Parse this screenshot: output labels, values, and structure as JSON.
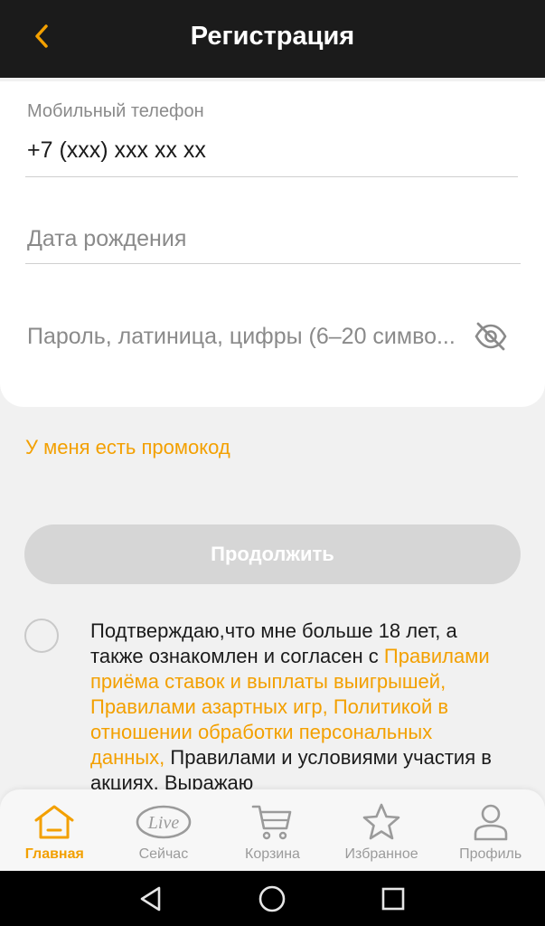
{
  "header": {
    "title": "Регистрация",
    "back_icon": "chevron-left-icon",
    "accent_color": "#f3a000"
  },
  "form": {
    "phone": {
      "label": "Мобильный телефон",
      "value": "+7 (xxx) xxx xx xx"
    },
    "birthdate": {
      "placeholder": "Дата рождения"
    },
    "password": {
      "placeholder": "Пароль, латиница, цифры (6–20 симво...",
      "visibility_icon": "eye-off-icon"
    }
  },
  "promo": {
    "label": "У меня есть промокод"
  },
  "continue_button": {
    "label": "Продолжить"
  },
  "consent": {
    "text_part1": "Подтверждаю,что мне больше 18 лет, а также ознакомлен и согласен с ",
    "link_text": "Правилами приёма ставок и выплаты выигрышей, Правилами азартных игр, Политикой в отношении обработки персональных данных,",
    "text_part2": " Правилами и условиями участия в акциях. Выражаю"
  },
  "bottom_nav": {
    "items": [
      {
        "label": "Главная",
        "icon": "home-icon",
        "active": true
      },
      {
        "label": "Сейчас",
        "icon": "live-icon",
        "badge": "Live"
      },
      {
        "label": "Корзина",
        "icon": "cart-icon"
      },
      {
        "label": "Избранное",
        "icon": "star-icon"
      },
      {
        "label": "Профиль",
        "icon": "profile-icon"
      }
    ]
  },
  "system_bar": {
    "buttons": [
      "back-triangle-icon",
      "home-circle-icon",
      "recents-square-icon"
    ]
  }
}
